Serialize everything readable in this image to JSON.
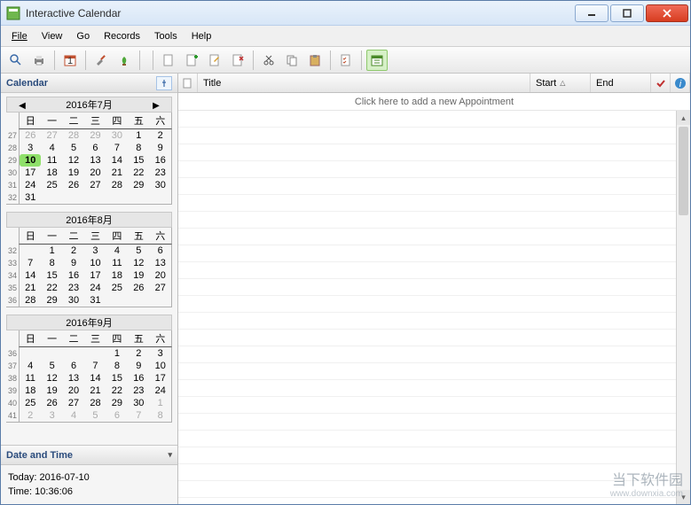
{
  "window": {
    "title": "Interactive Calendar"
  },
  "menu": {
    "file": "File",
    "view": "View",
    "go": "Go",
    "records": "Records",
    "tools": "Tools",
    "help": "Help"
  },
  "sidebar": {
    "calendar_label": "Calendar",
    "datetime_label": "Date and Time",
    "today_label": "Today: 2016-07-10",
    "time_label": "Time: 10:36:06"
  },
  "months": [
    {
      "title": "2016年7月",
      "show_nav": true,
      "weeks": [
        {
          "wk": "27",
          "days": [
            {
              "n": "26",
              "dim": true
            },
            {
              "n": "27",
              "dim": true
            },
            {
              "n": "28",
              "dim": true
            },
            {
              "n": "29",
              "dim": true
            },
            {
              "n": "30",
              "dim": true
            },
            {
              "n": "1"
            },
            {
              "n": "2"
            }
          ]
        },
        {
          "wk": "28",
          "days": [
            {
              "n": "3"
            },
            {
              "n": "4"
            },
            {
              "n": "5"
            },
            {
              "n": "6"
            },
            {
              "n": "7"
            },
            {
              "n": "8"
            },
            {
              "n": "9"
            }
          ]
        },
        {
          "wk": "29",
          "days": [
            {
              "n": "10",
              "today": true
            },
            {
              "n": "11"
            },
            {
              "n": "12"
            },
            {
              "n": "13"
            },
            {
              "n": "14"
            },
            {
              "n": "15"
            },
            {
              "n": "16"
            }
          ]
        },
        {
          "wk": "30",
          "days": [
            {
              "n": "17"
            },
            {
              "n": "18"
            },
            {
              "n": "19"
            },
            {
              "n": "20"
            },
            {
              "n": "21"
            },
            {
              "n": "22"
            },
            {
              "n": "23"
            }
          ]
        },
        {
          "wk": "31",
          "days": [
            {
              "n": "24"
            },
            {
              "n": "25"
            },
            {
              "n": "26"
            },
            {
              "n": "27"
            },
            {
              "n": "28"
            },
            {
              "n": "29"
            },
            {
              "n": "30"
            }
          ]
        },
        {
          "wk": "32",
          "days": [
            {
              "n": "31"
            },
            {
              "n": ""
            },
            {
              "n": ""
            },
            {
              "n": ""
            },
            {
              "n": ""
            },
            {
              "n": ""
            },
            {
              "n": ""
            }
          ]
        }
      ]
    },
    {
      "title": "2016年8月",
      "show_nav": false,
      "weeks": [
        {
          "wk": "32",
          "days": [
            {
              "n": ""
            },
            {
              "n": "1"
            },
            {
              "n": "2"
            },
            {
              "n": "3"
            },
            {
              "n": "4"
            },
            {
              "n": "5"
            },
            {
              "n": "6"
            }
          ]
        },
        {
          "wk": "33",
          "days": [
            {
              "n": "7"
            },
            {
              "n": "8"
            },
            {
              "n": "9"
            },
            {
              "n": "10"
            },
            {
              "n": "11"
            },
            {
              "n": "12"
            },
            {
              "n": "13"
            }
          ]
        },
        {
          "wk": "34",
          "days": [
            {
              "n": "14"
            },
            {
              "n": "15"
            },
            {
              "n": "16"
            },
            {
              "n": "17"
            },
            {
              "n": "18"
            },
            {
              "n": "19"
            },
            {
              "n": "20"
            }
          ]
        },
        {
          "wk": "35",
          "days": [
            {
              "n": "21"
            },
            {
              "n": "22"
            },
            {
              "n": "23"
            },
            {
              "n": "24"
            },
            {
              "n": "25"
            },
            {
              "n": "26"
            },
            {
              "n": "27"
            }
          ]
        },
        {
          "wk": "36",
          "days": [
            {
              "n": "28"
            },
            {
              "n": "29"
            },
            {
              "n": "30"
            },
            {
              "n": "31"
            },
            {
              "n": ""
            },
            {
              "n": ""
            },
            {
              "n": ""
            }
          ]
        }
      ]
    },
    {
      "title": "2016年9月",
      "show_nav": false,
      "weeks": [
        {
          "wk": "36",
          "days": [
            {
              "n": ""
            },
            {
              "n": ""
            },
            {
              "n": ""
            },
            {
              "n": ""
            },
            {
              "n": "1"
            },
            {
              "n": "2"
            },
            {
              "n": "3"
            }
          ]
        },
        {
          "wk": "37",
          "days": [
            {
              "n": "4"
            },
            {
              "n": "5"
            },
            {
              "n": "6"
            },
            {
              "n": "7"
            },
            {
              "n": "8"
            },
            {
              "n": "9"
            },
            {
              "n": "10"
            }
          ]
        },
        {
          "wk": "38",
          "days": [
            {
              "n": "11"
            },
            {
              "n": "12"
            },
            {
              "n": "13"
            },
            {
              "n": "14"
            },
            {
              "n": "15"
            },
            {
              "n": "16"
            },
            {
              "n": "17"
            }
          ]
        },
        {
          "wk": "39",
          "days": [
            {
              "n": "18"
            },
            {
              "n": "19"
            },
            {
              "n": "20"
            },
            {
              "n": "21"
            },
            {
              "n": "22"
            },
            {
              "n": "23"
            },
            {
              "n": "24"
            }
          ]
        },
        {
          "wk": "40",
          "days": [
            {
              "n": "25"
            },
            {
              "n": "26"
            },
            {
              "n": "27"
            },
            {
              "n": "28"
            },
            {
              "n": "29"
            },
            {
              "n": "30"
            },
            {
              "n": "1",
              "dim": true
            }
          ]
        },
        {
          "wk": "41",
          "days": [
            {
              "n": "2",
              "dim": true
            },
            {
              "n": "3",
              "dim": true
            },
            {
              "n": "4",
              "dim": true
            },
            {
              "n": "5",
              "dim": true
            },
            {
              "n": "6",
              "dim": true
            },
            {
              "n": "7",
              "dim": true
            },
            {
              "n": "8",
              "dim": true
            }
          ]
        }
      ]
    }
  ],
  "day_headers": [
    "日",
    "一",
    "二",
    "三",
    "四",
    "五",
    "六"
  ],
  "list": {
    "col_title": "Title",
    "col_start": "Start",
    "col_end": "End",
    "placeholder": "Click here to add a new Appointment"
  },
  "watermark": {
    "line1": "当下软件园",
    "line2": "www.downxia.com"
  }
}
